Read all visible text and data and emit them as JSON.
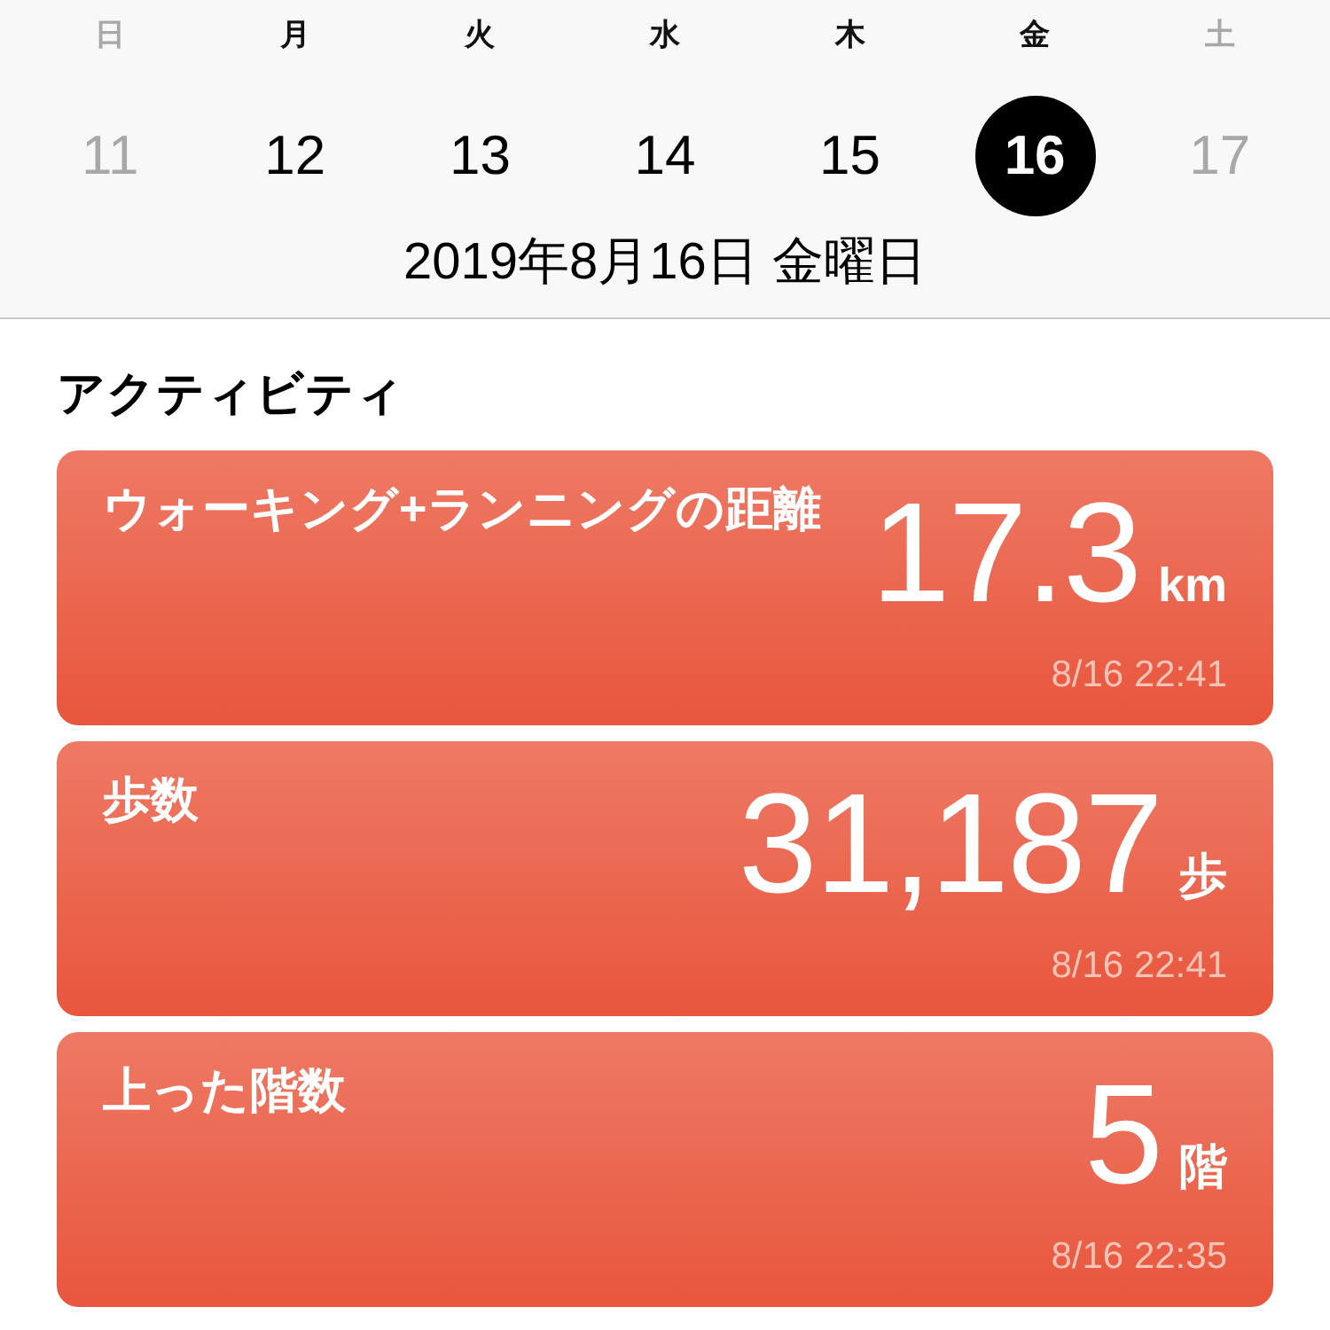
{
  "week": [
    {
      "weekday": "日",
      "day": "11",
      "dimmed": true,
      "selected": false
    },
    {
      "weekday": "月",
      "day": "12",
      "dimmed": false,
      "selected": false
    },
    {
      "weekday": "火",
      "day": "13",
      "dimmed": false,
      "selected": false
    },
    {
      "weekday": "水",
      "day": "14",
      "dimmed": false,
      "selected": false
    },
    {
      "weekday": "木",
      "day": "15",
      "dimmed": false,
      "selected": false
    },
    {
      "weekday": "金",
      "day": "16",
      "dimmed": false,
      "selected": true
    },
    {
      "weekday": "土",
      "day": "17",
      "dimmed": true,
      "selected": false
    }
  ],
  "date_label": "2019年8月16日 金曜日",
  "section_title": "アクティビティ",
  "cards": [
    {
      "title": "ウォーキング+ランニングの距離",
      "value": "17.3",
      "unit": "km",
      "time": "8/16 22:41"
    },
    {
      "title": "歩数",
      "value": "31,187",
      "unit": "歩",
      "time": "8/16 22:41"
    },
    {
      "title": "上った階数",
      "value": "5",
      "unit": "階",
      "time": "8/16 22:35"
    }
  ]
}
